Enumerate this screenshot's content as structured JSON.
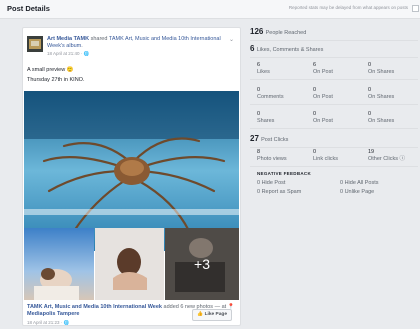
{
  "header": {
    "title": "Post Details",
    "note": "Reported stats may be delayed from what appears on posts"
  },
  "post": {
    "page_name": "Art Media TAMK",
    "shared_text": "shared",
    "shared_link": "TAMK Art, Music and Media 10th International Week's album",
    "shared_end": ".",
    "meta": "18 April at 21:40 · 🌐",
    "text_line1": "A small preview 🙂",
    "text_line2": "Thursday 27th in KINO.",
    "more_count": "+3",
    "footer_link": "TAMK Art, Music and Media 10th International Week",
    "footer_added": "added 6 new photos",
    "footer_at": "— at",
    "footer_place": "📍 Mediapolis Tampere",
    "footer_meta": "18 April at 21:23 · 🌐",
    "like_page_label": "👍 Like Page"
  },
  "stats": {
    "reached": {
      "value": "126",
      "label": "People Reached"
    },
    "engagement": {
      "value": "6",
      "label": "Likes, Comments & Shares"
    },
    "likes": {
      "total": "6",
      "total_label": "Likes",
      "on_post": "6",
      "on_post_label": "On Post",
      "on_shares": "0",
      "on_shares_label": "On Shares"
    },
    "comments": {
      "total": "0",
      "total_label": "Comments",
      "on_post": "0",
      "on_post_label": "On Post",
      "on_shares": "0",
      "on_shares_label": "On Shares"
    },
    "shares": {
      "total": "0",
      "total_label": "Shares",
      "on_post": "0",
      "on_post_label": "On Post",
      "on_shares": "0",
      "on_shares_label": "On Shares"
    },
    "clicks": {
      "value": "27",
      "label": "Post Clicks"
    },
    "click_breakdown": {
      "photo_views": "8",
      "photo_views_label": "Photo views",
      "link_clicks": "0",
      "link_clicks_label": "Link clicks",
      "other_clicks": "19",
      "other_clicks_label": "Other Clicks ⓘ"
    },
    "negative": {
      "heading": "NEGATIVE FEEDBACK",
      "hide_post": "0 Hide Post",
      "hide_all": "0 Hide All Posts",
      "report_spam": "0 Report as Spam",
      "unlike_page": "0 Unlike Page"
    }
  },
  "colors": {
    "link": "#365899",
    "muted": "#90949c",
    "border": "#dddfe2"
  }
}
